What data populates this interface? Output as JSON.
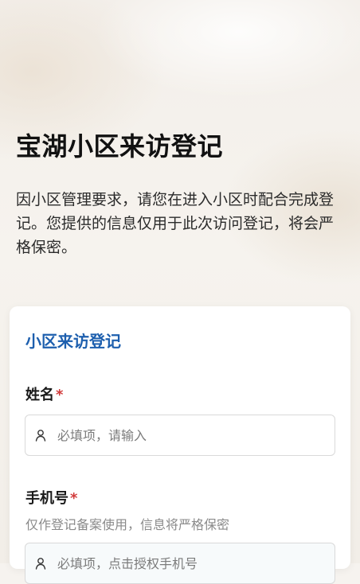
{
  "hero": {
    "title": "宝湖小区来访登记",
    "description": "因小区管理要求，请您在进入小区时配合完成登记。您提供的信息仅用于此次访问登记，将会严格保密。"
  },
  "form": {
    "title": "小区来访登记",
    "name_field": {
      "label": "姓名",
      "required_mark": "*",
      "placeholder": "必填项，请输入",
      "icon": "person-icon"
    },
    "phone_field": {
      "label": "手机号",
      "required_mark": "*",
      "hint": "仅作登记备案使用，信息将严格保密",
      "placeholder": "必填项，点击授权手机号",
      "icon": "person-icon"
    }
  },
  "colors": {
    "accent": "#1d5fae",
    "required": "#d13b3b"
  }
}
